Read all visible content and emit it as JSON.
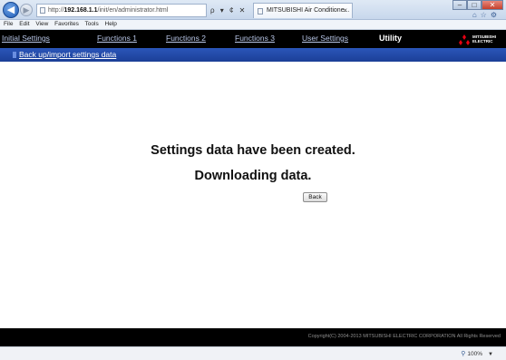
{
  "browser": {
    "address_prefix": "http://",
    "address_host": "192.168.1.1",
    "address_path": "/init/en/administrator.html",
    "address_actions": "ρ ▾ ¢ ✕",
    "tab_title": "MITSUBISHI Air Conditione...",
    "tab_close": "×",
    "menu": [
      "File",
      "Edit",
      "View",
      "Favorites",
      "Tools",
      "Help"
    ],
    "zoom": "100%"
  },
  "nav": {
    "items": [
      "Initial Settings",
      "Functions 1",
      "Functions 2",
      "Functions 3",
      "User Settings"
    ],
    "active": "Utility",
    "logo_line1": "MITSUBISHI",
    "logo_line2": "ELECTRIC"
  },
  "subnav": {
    "link": "Back up/import settings data"
  },
  "content": {
    "message1": "Settings data have been created.",
    "message2": "Downloading data.",
    "back_button": "Back"
  },
  "footer": {
    "copyright": "Copyright(C) 2004-2013 MITSUBISHI ELECTRIC CORPORATION All Rights Reserved"
  },
  "colors": {
    "nav_background": "#000000",
    "subnav_background": "#1f45a3",
    "accent_red": "#e60012"
  }
}
